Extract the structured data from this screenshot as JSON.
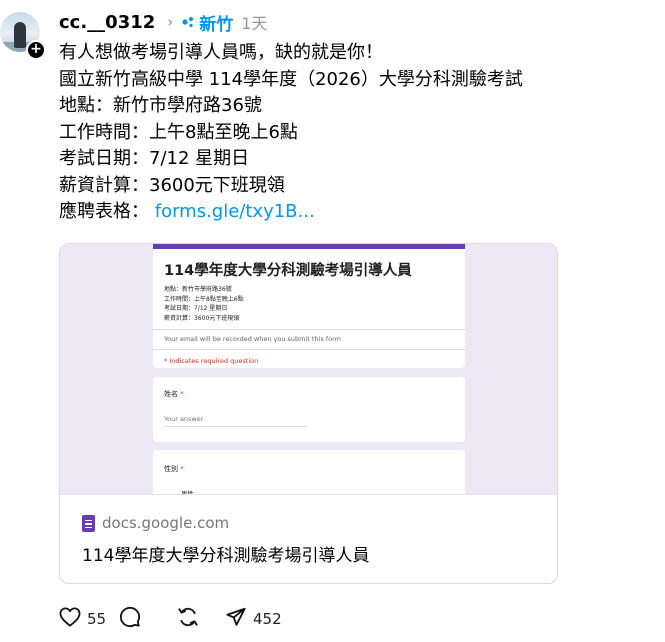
{
  "post": {
    "username": "cc.__0312",
    "topic": "新竹",
    "time": "1天",
    "lines": [
      "有人想做考場引導人員嗎，缺的就是你！",
      "國立新竹高級中學 114學年度（2026）大學分科測驗考試",
      "地點：新竹市學府路36號",
      "工作時間：上午8點至晚上6點",
      "考試日期：7/12 星期日",
      "薪資計算：3600元下班現領"
    ],
    "form_label": "應聘表格：",
    "link_text": "forms.gle/txy1B..."
  },
  "card": {
    "domain": "docs.google.com",
    "title": "114學年度大學分科測驗考場引導人員",
    "preview": {
      "form_title": "114學年度大學分科測驗考場引導人員",
      "info_lines": [
        "地點：新竹市學府路36號",
        "工作時間：上午8點至晚上6點",
        "考試日期：7/12 星期日",
        "薪資計算：3600元下班現領"
      ],
      "email_note": "Your email will be recorded when you submit this form",
      "required_note": "* Indicates required question",
      "q1_label": "姓名",
      "q1_placeholder": "Your answer",
      "q2_label": "性別",
      "q2_option": "男性",
      "req_mark": "*"
    }
  },
  "actions": {
    "likes": "55",
    "reposts": "",
    "shares": "452"
  },
  "colors": {
    "link_blue": "#0095f6",
    "form_purple": "#673ab7",
    "form_bg": "#ede7f6",
    "required_red": "#d93025"
  },
  "icons": [
    "plus-icon",
    "chevron-right-icon",
    "topic-dots-icon",
    "heart-icon",
    "comment-icon",
    "repost-icon",
    "share-icon",
    "google-forms-icon"
  ]
}
